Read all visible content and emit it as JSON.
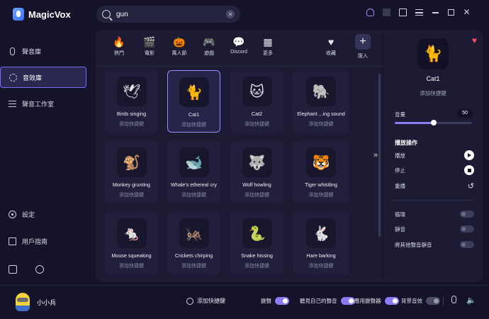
{
  "app": {
    "title": "MagicVox"
  },
  "search": {
    "value": "gun",
    "placeholder": ""
  },
  "sidebar": {
    "items": [
      {
        "label": "聲音庫",
        "icon": "mic-icon"
      },
      {
        "label": "音效庫",
        "icon": "sound-effects-icon",
        "active": true
      },
      {
        "label": "聲音工作室",
        "icon": "studio-sliders-icon"
      }
    ],
    "bottom_items": [
      {
        "label": "設定",
        "icon": "settings-icon"
      },
      {
        "label": "用戶指南",
        "icon": "guide-icon"
      }
    ]
  },
  "categories": [
    {
      "label": "熱門",
      "icon": "fire-icon",
      "glyph": "🔥"
    },
    {
      "label": "電影",
      "icon": "clapperboard-icon",
      "glyph": "🎬"
    },
    {
      "label": "萬人節",
      "icon": "ghost-icon",
      "glyph": "🎃"
    },
    {
      "label": "遊戲",
      "icon": "gamepad-icon",
      "glyph": "🎮"
    },
    {
      "label": "Discord",
      "icon": "discord-icon",
      "glyph": "💬"
    },
    {
      "label": "更多",
      "icon": "more-grid-icon",
      "glyph": "▦"
    },
    {
      "label": "收藏",
      "icon": "heart-icon",
      "glyph": "♥"
    },
    {
      "label": "匯入",
      "icon": "plus-icon",
      "glyph": "+"
    }
  ],
  "sounds": [
    {
      "name": "Birds singing",
      "hotkey": "添加快捷鍵",
      "glyph": "🕊"
    },
    {
      "name": "Cat1",
      "hotkey": "添加快捷鍵",
      "glyph": "🐈",
      "selected": true
    },
    {
      "name": "Cat2",
      "hotkey": "添加快捷鍵",
      "glyph": "🐱"
    },
    {
      "name": "Elephant ...ing sound",
      "hotkey": "添加快捷鍵",
      "glyph": "🐘"
    },
    {
      "name": "Monkey grunting",
      "hotkey": "添加快捷鍵",
      "glyph": "🐒"
    },
    {
      "name": "Whale's ethereal cry",
      "hotkey": "添加快捷鍵",
      "glyph": "🐋"
    },
    {
      "name": "Wolf howling",
      "hotkey": "添加快捷鍵",
      "glyph": "🐺"
    },
    {
      "name": "Tiger whistling",
      "hotkey": "添加快捷鍵",
      "glyph": "🐯"
    },
    {
      "name": "Mouse squeaking",
      "hotkey": "添加快捷鍵",
      "glyph": "🐁"
    },
    {
      "name": "Crickets chirping",
      "hotkey": "添加快捷鍵",
      "glyph": "🦗"
    },
    {
      "name": "Snake hissing",
      "hotkey": "添加快捷鍵",
      "glyph": "🐍"
    },
    {
      "name": "Hare barking",
      "hotkey": "添加快捷鍵",
      "glyph": "🐇"
    }
  ],
  "detail": {
    "title": "Cat1",
    "hotkey": "添加快捷鍵",
    "glyph": "🐈",
    "volume_label": "音量",
    "volume_value": "50",
    "volume_fraction": 0.5,
    "section_title": "播放操作",
    "play_label": "播放",
    "stop_label": "停止",
    "repeat_label": "重播",
    "loop_label": "循環",
    "mute_label": "靜音",
    "mute_others_label": "將其他聲音靜音"
  },
  "bottom": {
    "username": "小小兵",
    "add_hotkey": "添加快捷鍵",
    "voice_change_label": "變聲",
    "hear_self_label": "聽見自己的聲音",
    "apply_voice_label": "應用變聲器",
    "bg_effect_label": "背景音效"
  },
  "colors": {
    "accent": "#8b7cf6",
    "favorite": "#ff4d6d",
    "background": "#14132a",
    "panel": "#1c1b33"
  }
}
